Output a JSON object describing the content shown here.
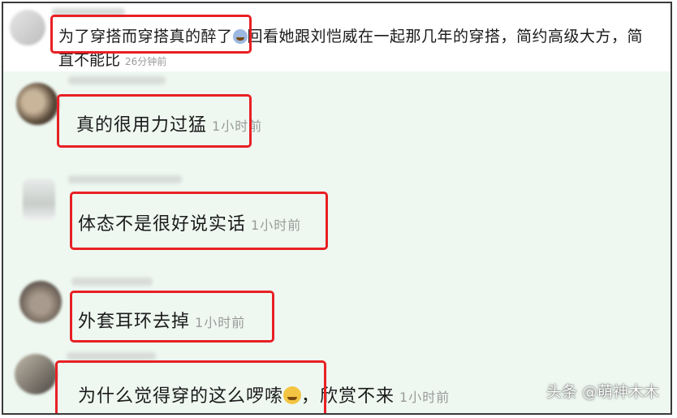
{
  "top_comment": {
    "text_before_emoji": "为了穿搭而穿搭真的醉了",
    "emoji": "sweat-smile-emoji",
    "text_after_emoji": "回看她跟刘恺威在一起那几年的穿搭，简约高级大方，简",
    "line2": "直不能比",
    "time": "26分钟前"
  },
  "replies": [
    {
      "text": "真的很用力过猛",
      "time": "1小时前"
    },
    {
      "text": "体态不是很好说实话",
      "time": "1小时前"
    },
    {
      "text": "外套耳环去掉",
      "time": "1小时前"
    },
    {
      "text_before_emoji": "为什么觉得穿的这么啰嗦",
      "emoji": "crying-laughing-emoji",
      "text_after_emoji": "，欣赏不来",
      "time": "1小时前"
    }
  ],
  "watermark": "头条 @萌神木木",
  "colors": {
    "highlight": "#e82024",
    "thread_bg": "#eef8f1",
    "time": "#9a9a9a"
  }
}
